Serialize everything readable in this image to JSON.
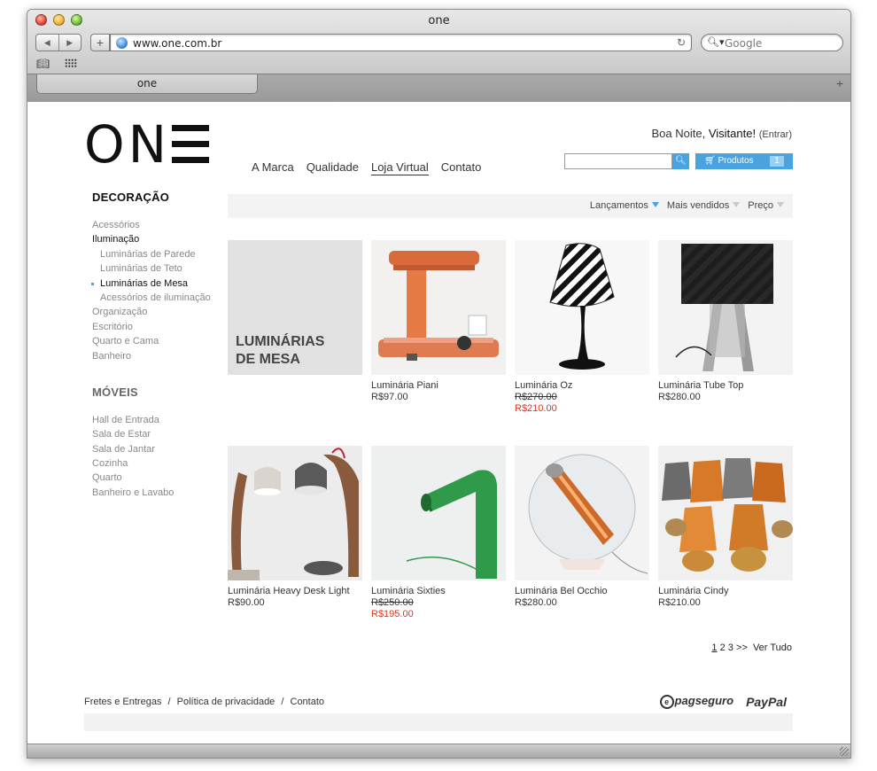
{
  "browser": {
    "window_title": "one",
    "url": "www.one.com.br",
    "search_placeholder": "Google",
    "tab_title": "one"
  },
  "header": {
    "logo_text": "ON",
    "nav": [
      "A Marca",
      "Qualidade",
      "Loja Virtual",
      "Contato"
    ],
    "greeting_prefix": "Boa Noite, ",
    "greeting_name": "Visitante!",
    "greeting_link": "(Entrar)",
    "search_value": "",
    "cart_label": "Produtos",
    "cart_count": "1"
  },
  "sidebar": {
    "section1_title": "DECORAÇÃO",
    "section1_items": [
      "Acessórios",
      "Iluminação",
      "Luminárias de Parede",
      "Luminárias de Teto",
      "Luminárias de Mesa",
      "Acessórios de iluminação",
      "Organização",
      "Escritório",
      "Quarto e Cama",
      "Banheiro"
    ],
    "section2_title": "MÓVEIS",
    "section2_items": [
      "Hall de Entrada",
      "Sala de Estar",
      "Sala de Jantar",
      "Cozinha",
      "Quarto",
      "Banheiro e Lavabo"
    ]
  },
  "sort": {
    "options": [
      "Lançamentos",
      "Mais vendidos",
      "Preço"
    ]
  },
  "banner": {
    "line1": "LUMINÁRIAS",
    "line2": "DE MESA"
  },
  "products": [
    {
      "name": "Luminária Piani",
      "price": "R$97.00",
      "old_price": "",
      "icon": "orange-desk-lamp"
    },
    {
      "name": "Luminária Oz",
      "price": "R$210.00",
      "old_price": "R$270.00",
      "icon": "striped-table-lamp"
    },
    {
      "name": "Luminária Tube Top",
      "price": "R$280.00",
      "old_price": "",
      "icon": "black-shade-lamp"
    },
    {
      "name": "Luminária Heavy Desk Light",
      "price": "R$90.00",
      "old_price": "",
      "icon": "wooden-desk-lamps"
    },
    {
      "name": "Luminária Sixties",
      "price": "R$195.00",
      "old_price": "R$250.00",
      "icon": "green-tube-lamp"
    },
    {
      "name": "Luminária Bel Occhio",
      "price": "R$280.00",
      "old_price": "",
      "icon": "glass-sphere-lamp"
    },
    {
      "name": "Luminária Cindy",
      "price": "R$210.00",
      "old_price": "",
      "icon": "metallic-lamps"
    }
  ],
  "pagination": {
    "current": "1",
    "pages": [
      "2",
      "3"
    ],
    "next": ">>",
    "view_all": "Ver Tudo"
  },
  "footer": {
    "links": [
      "Fretes e Entregas",
      "Política de privacidade",
      "Contato"
    ],
    "separator": "/",
    "pay1": "pagseguro",
    "pay2": "PayPal"
  },
  "colors": {
    "accent": "#4aa3df",
    "sale": "#d9361f",
    "banner_bg": "#e1e1e1"
  }
}
